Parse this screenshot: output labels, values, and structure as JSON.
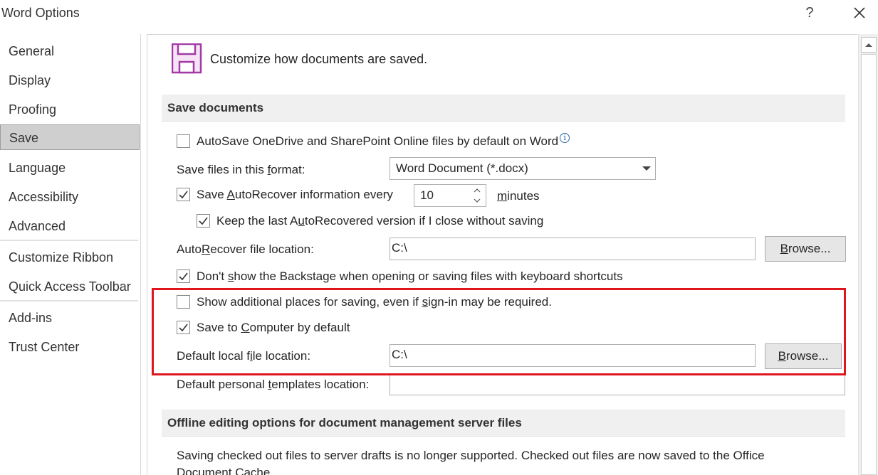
{
  "window": {
    "title": "Word Options",
    "help_label": "?",
    "close_icon": "close-icon"
  },
  "sidebar": {
    "items": [
      {
        "label": "General"
      },
      {
        "label": "Display"
      },
      {
        "label": "Proofing"
      },
      {
        "label": "Save",
        "selected": true
      },
      {
        "label": "Language"
      },
      {
        "label": "Accessibility"
      },
      {
        "label": "Advanced"
      },
      {
        "label": "Customize Ribbon"
      },
      {
        "label": "Quick Access Toolbar"
      },
      {
        "label": "Add-ins"
      },
      {
        "label": "Trust Center"
      }
    ]
  },
  "header": {
    "icon": "save-floppy-icon",
    "text": "Customize how documents are saved."
  },
  "save_documents": {
    "section_title": "Save documents",
    "autosave": {
      "label": "AutoSave OneDrive and SharePoint Online files by default on Word",
      "checked": false,
      "info_glyph": "i"
    },
    "format": {
      "label_pre": "Save files in this ",
      "label_u": "f",
      "label_post": "ormat:",
      "value": "Word Document (*.docx)"
    },
    "autorecover": {
      "label_pre": "Save ",
      "label_u": "A",
      "label_post": "utoRecover information every",
      "checked": true,
      "value": "10",
      "unit_u": "m",
      "unit_post": "inutes"
    },
    "keep_last": {
      "label_pre": "Keep the last A",
      "label_u": "u",
      "label_post": "toRecovered version if I close without saving",
      "checked": true
    },
    "autorecover_location": {
      "label_pre": "Auto",
      "label_u": "R",
      "label_post": "ecover file location:",
      "value": "C:\\",
      "browse_u": "B",
      "browse_post": "rowse..."
    },
    "backstage": {
      "label_pre": "Don't ",
      "label_u": "s",
      "label_post": "how the Backstage when opening or saving files with keyboard shortcuts",
      "checked": true
    },
    "additional_places": {
      "label_pre": "Show additional places for saving, even if ",
      "label_u": "s",
      "label_post": "ign-in may be required.",
      "checked": false
    },
    "save_to_computer": {
      "label_pre": "Save to ",
      "label_u": "C",
      "label_post": "omputer by default",
      "checked": true
    },
    "default_location": {
      "label_pre": "Default local f",
      "label_u": "i",
      "label_post": "le location:",
      "value": "C:\\",
      "browse_u": "B",
      "browse_post": "rowse..."
    },
    "templates_location": {
      "label_pre": "Default personal ",
      "label_u": "t",
      "label_post": "emplates location:",
      "value": ""
    }
  },
  "offline": {
    "section_title": "Offline editing options for document management server files",
    "paragraph": "Saving checked out files to server drafts is no longer supported. Checked out files are now saved to the Office Document Cache."
  },
  "colors": {
    "highlight": "#e0161f",
    "save_icon": "#a23aa6"
  }
}
